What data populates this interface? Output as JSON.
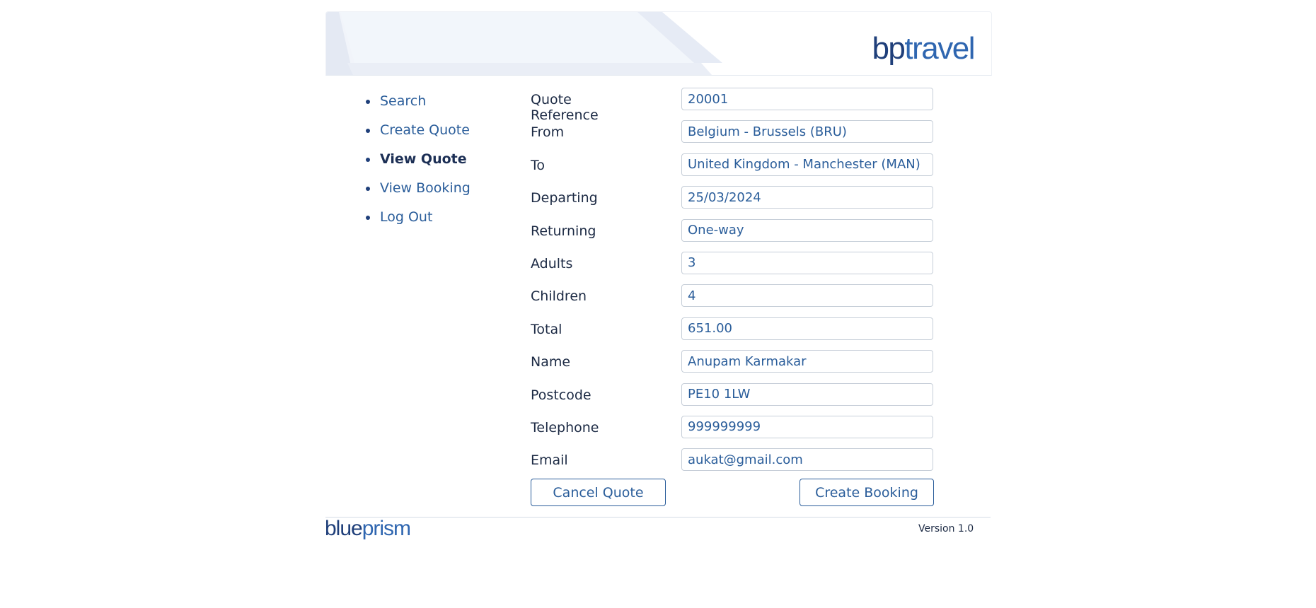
{
  "header": {
    "logo_part1": "bp",
    "logo_part2": "travel"
  },
  "nav": {
    "items": [
      {
        "label": "Search",
        "active": false
      },
      {
        "label": "Create Quote",
        "active": false
      },
      {
        "label": "View Quote",
        "active": true
      },
      {
        "label": "View Booking",
        "active": false
      },
      {
        "label": "Log Out",
        "active": false
      }
    ]
  },
  "form": {
    "fields": [
      {
        "label": "Quote Reference",
        "value": "20001"
      },
      {
        "label": "From",
        "value": "Belgium - Brussels (BRU)"
      },
      {
        "label": "To",
        "value": "United Kingdom - Manchester (MAN)"
      },
      {
        "label": "Departing",
        "value": "25/03/2024"
      },
      {
        "label": "Returning",
        "value": "One-way"
      },
      {
        "label": "Adults",
        "value": "3"
      },
      {
        "label": "Children",
        "value": "4"
      },
      {
        "label": "Total",
        "value": "651.00"
      },
      {
        "label": "Name",
        "value": "Anupam Karmakar"
      },
      {
        "label": "Postcode",
        "value": "PE10 1LW"
      },
      {
        "label": "Telephone",
        "value": "999999999"
      },
      {
        "label": "Email",
        "value": "aukat@gmail.com"
      }
    ]
  },
  "buttons": {
    "cancel_label": "Cancel Quote",
    "create_label": "Create Booking"
  },
  "footer": {
    "logo_part1": "blue",
    "logo_part2": "prism",
    "version": "Version 1.0"
  },
  "colors": {
    "brand_dark": "#1f3f7a",
    "brand_light": "#2f66b0",
    "link": "#2a5d9a"
  }
}
